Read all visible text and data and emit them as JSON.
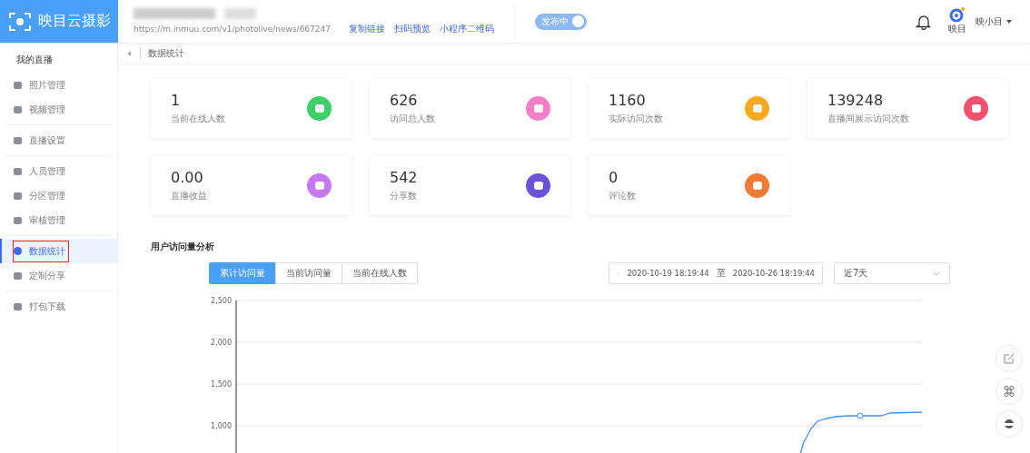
{
  "header": {
    "brand": "映目云摄影",
    "url": "https://m.inmuu.com/v1/photolive/news/667247",
    "links": [
      "复制链接",
      "扫码预览",
      "小程序二维码"
    ],
    "publish_toggle": {
      "label": "发布中",
      "on": true
    },
    "app_logo_label": "映目",
    "user_name": "映小目"
  },
  "sidebar": {
    "section_title": "我的直播",
    "groups": [
      {
        "items": [
          {
            "label": "照片管理",
            "selected": false,
            "annotated": false
          },
          {
            "label": "视频管理",
            "selected": false,
            "annotated": false
          }
        ]
      },
      {
        "items": [
          {
            "label": "直播设置",
            "selected": false,
            "annotated": false
          }
        ]
      },
      {
        "items": [
          {
            "label": "人员管理",
            "selected": false,
            "annotated": false
          },
          {
            "label": "分区管理",
            "selected": false,
            "annotated": false
          },
          {
            "label": "审核管理",
            "selected": false,
            "annotated": false
          }
        ]
      },
      {
        "items": [
          {
            "label": "数据统计",
            "selected": true,
            "annotated": true
          },
          {
            "label": "定制分享",
            "selected": false,
            "annotated": false
          }
        ]
      },
      {
        "items": [
          {
            "label": "打包下载",
            "selected": false,
            "annotated": false
          }
        ]
      }
    ]
  },
  "breadcrumb": "数据统计",
  "stats": [
    {
      "value": "1",
      "label": "当前在线人数",
      "color": "#3ecf6a"
    },
    {
      "value": "626",
      "label": "访问总人数",
      "color": "#f57fc9"
    },
    {
      "value": "1160",
      "label": "实际访问次数",
      "color": "#fbaa1c"
    },
    {
      "value": "139248",
      "label": "直播间展示访问次数",
      "color": "#f5516f"
    },
    {
      "value": "0.00",
      "label": "直播收益",
      "color": "#c678f5"
    },
    {
      "value": "542",
      "label": "分享数",
      "color": "#6a52d9"
    },
    {
      "value": "0",
      "label": "评论数",
      "color": "#f57a36"
    }
  ],
  "analysis": {
    "title": "用户访问量分析",
    "tabs": [
      {
        "label": "累计访问量",
        "selected": true
      },
      {
        "label": "当前访问量",
        "selected": false
      },
      {
        "label": "当前在线人数",
        "selected": false
      }
    ],
    "date_range": {
      "start": "2020-10-19 18:19:44",
      "separator": "至",
      "end": "2020-10-26 18:19:44"
    },
    "period_select": {
      "value": "近7天"
    },
    "chart": {
      "y_tick_labels": [
        "2,500",
        "2,000",
        "1,500",
        "1,000"
      ]
    }
  }
}
